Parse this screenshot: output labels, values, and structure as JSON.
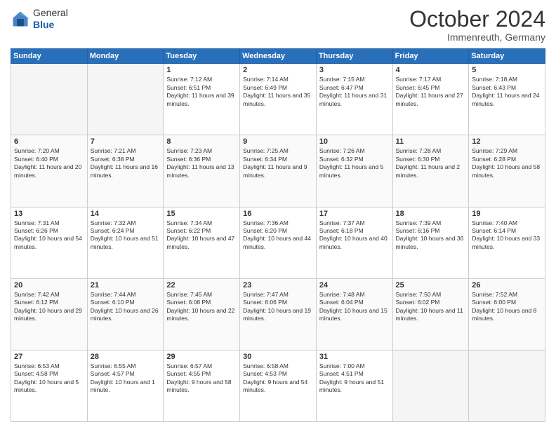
{
  "header": {
    "logo": {
      "general": "General",
      "blue": "Blue"
    },
    "title": "October 2024",
    "location": "Immenreuth, Germany"
  },
  "weekdays": [
    "Sunday",
    "Monday",
    "Tuesday",
    "Wednesday",
    "Thursday",
    "Friday",
    "Saturday"
  ],
  "weeks": [
    [
      {
        "day": "",
        "info": ""
      },
      {
        "day": "",
        "info": ""
      },
      {
        "day": "1",
        "info": "Sunrise: 7:12 AM\nSunset: 6:51 PM\nDaylight: 11 hours and 39 minutes."
      },
      {
        "day": "2",
        "info": "Sunrise: 7:14 AM\nSunset: 6:49 PM\nDaylight: 11 hours and 35 minutes."
      },
      {
        "day": "3",
        "info": "Sunrise: 7:15 AM\nSunset: 6:47 PM\nDaylight: 11 hours and 31 minutes."
      },
      {
        "day": "4",
        "info": "Sunrise: 7:17 AM\nSunset: 6:45 PM\nDaylight: 11 hours and 27 minutes."
      },
      {
        "day": "5",
        "info": "Sunrise: 7:18 AM\nSunset: 6:43 PM\nDaylight: 11 hours and 24 minutes."
      }
    ],
    [
      {
        "day": "6",
        "info": "Sunrise: 7:20 AM\nSunset: 6:40 PM\nDaylight: 11 hours and 20 minutes."
      },
      {
        "day": "7",
        "info": "Sunrise: 7:21 AM\nSunset: 6:38 PM\nDaylight: 11 hours and 16 minutes."
      },
      {
        "day": "8",
        "info": "Sunrise: 7:23 AM\nSunset: 6:36 PM\nDaylight: 11 hours and 13 minutes."
      },
      {
        "day": "9",
        "info": "Sunrise: 7:25 AM\nSunset: 6:34 PM\nDaylight: 11 hours and 9 minutes."
      },
      {
        "day": "10",
        "info": "Sunrise: 7:26 AM\nSunset: 6:32 PM\nDaylight: 11 hours and 5 minutes."
      },
      {
        "day": "11",
        "info": "Sunrise: 7:28 AM\nSunset: 6:30 PM\nDaylight: 11 hours and 2 minutes."
      },
      {
        "day": "12",
        "info": "Sunrise: 7:29 AM\nSunset: 6:28 PM\nDaylight: 10 hours and 58 minutes."
      }
    ],
    [
      {
        "day": "13",
        "info": "Sunrise: 7:31 AM\nSunset: 6:26 PM\nDaylight: 10 hours and 54 minutes."
      },
      {
        "day": "14",
        "info": "Sunrise: 7:32 AM\nSunset: 6:24 PM\nDaylight: 10 hours and 51 minutes."
      },
      {
        "day": "15",
        "info": "Sunrise: 7:34 AM\nSunset: 6:22 PM\nDaylight: 10 hours and 47 minutes."
      },
      {
        "day": "16",
        "info": "Sunrise: 7:36 AM\nSunset: 6:20 PM\nDaylight: 10 hours and 44 minutes."
      },
      {
        "day": "17",
        "info": "Sunrise: 7:37 AM\nSunset: 6:18 PM\nDaylight: 10 hours and 40 minutes."
      },
      {
        "day": "18",
        "info": "Sunrise: 7:39 AM\nSunset: 6:16 PM\nDaylight: 10 hours and 36 minutes."
      },
      {
        "day": "19",
        "info": "Sunrise: 7:40 AM\nSunset: 6:14 PM\nDaylight: 10 hours and 33 minutes."
      }
    ],
    [
      {
        "day": "20",
        "info": "Sunrise: 7:42 AM\nSunset: 6:12 PM\nDaylight: 10 hours and 29 minutes."
      },
      {
        "day": "21",
        "info": "Sunrise: 7:44 AM\nSunset: 6:10 PM\nDaylight: 10 hours and 26 minutes."
      },
      {
        "day": "22",
        "info": "Sunrise: 7:45 AM\nSunset: 6:08 PM\nDaylight: 10 hours and 22 minutes."
      },
      {
        "day": "23",
        "info": "Sunrise: 7:47 AM\nSunset: 6:06 PM\nDaylight: 10 hours and 19 minutes."
      },
      {
        "day": "24",
        "info": "Sunrise: 7:48 AM\nSunset: 6:04 PM\nDaylight: 10 hours and 15 minutes."
      },
      {
        "day": "25",
        "info": "Sunrise: 7:50 AM\nSunset: 6:02 PM\nDaylight: 10 hours and 11 minutes."
      },
      {
        "day": "26",
        "info": "Sunrise: 7:52 AM\nSunset: 6:00 PM\nDaylight: 10 hours and 8 minutes."
      }
    ],
    [
      {
        "day": "27",
        "info": "Sunrise: 6:53 AM\nSunset: 4:58 PM\nDaylight: 10 hours and 5 minutes."
      },
      {
        "day": "28",
        "info": "Sunrise: 6:55 AM\nSunset: 4:57 PM\nDaylight: 10 hours and 1 minute."
      },
      {
        "day": "29",
        "info": "Sunrise: 6:57 AM\nSunset: 4:55 PM\nDaylight: 9 hours and 58 minutes."
      },
      {
        "day": "30",
        "info": "Sunrise: 6:58 AM\nSunset: 4:53 PM\nDaylight: 9 hours and 54 minutes."
      },
      {
        "day": "31",
        "info": "Sunrise: 7:00 AM\nSunset: 4:51 PM\nDaylight: 9 hours and 51 minutes."
      },
      {
        "day": "",
        "info": ""
      },
      {
        "day": "",
        "info": ""
      }
    ]
  ]
}
